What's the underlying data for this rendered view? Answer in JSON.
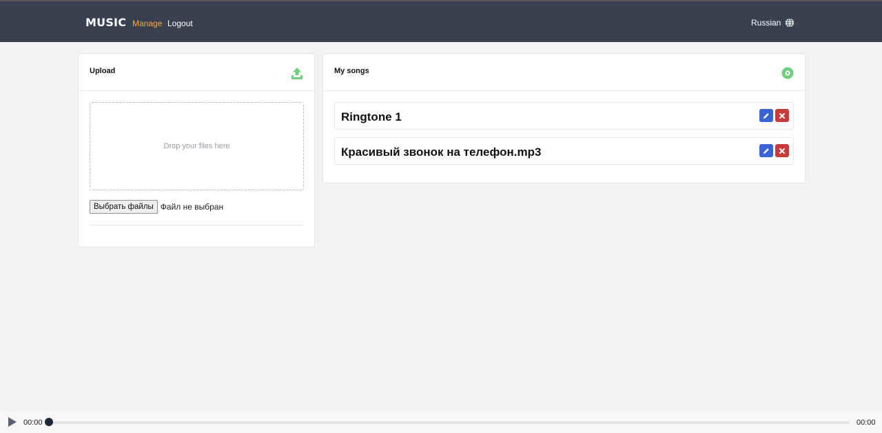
{
  "nav": {
    "brand": "MUSIC",
    "manage": "Manage",
    "logout": "Logout",
    "language": "Russian",
    "language_icon": "globe-icon"
  },
  "upload": {
    "title": "Upload",
    "icon": "upload-icon",
    "dropzone": "Drop your files here",
    "choose_button": "Выбрать файлы",
    "no_file": "Файл не выбран"
  },
  "songs": {
    "title": "My songs",
    "icon": "disc-icon",
    "items": [
      {
        "title": "Ringtone 1"
      },
      {
        "title": "Красивый звонок на телефон.mp3"
      }
    ]
  },
  "player": {
    "current_time": "00:00",
    "total_time": "00:00",
    "progress": 0
  },
  "colors": {
    "navbar": "#394150",
    "active_link": "#f5a54a",
    "icon_green": "#6fcf7f",
    "edit": "#3a63d8",
    "delete": "#c93a3a"
  }
}
